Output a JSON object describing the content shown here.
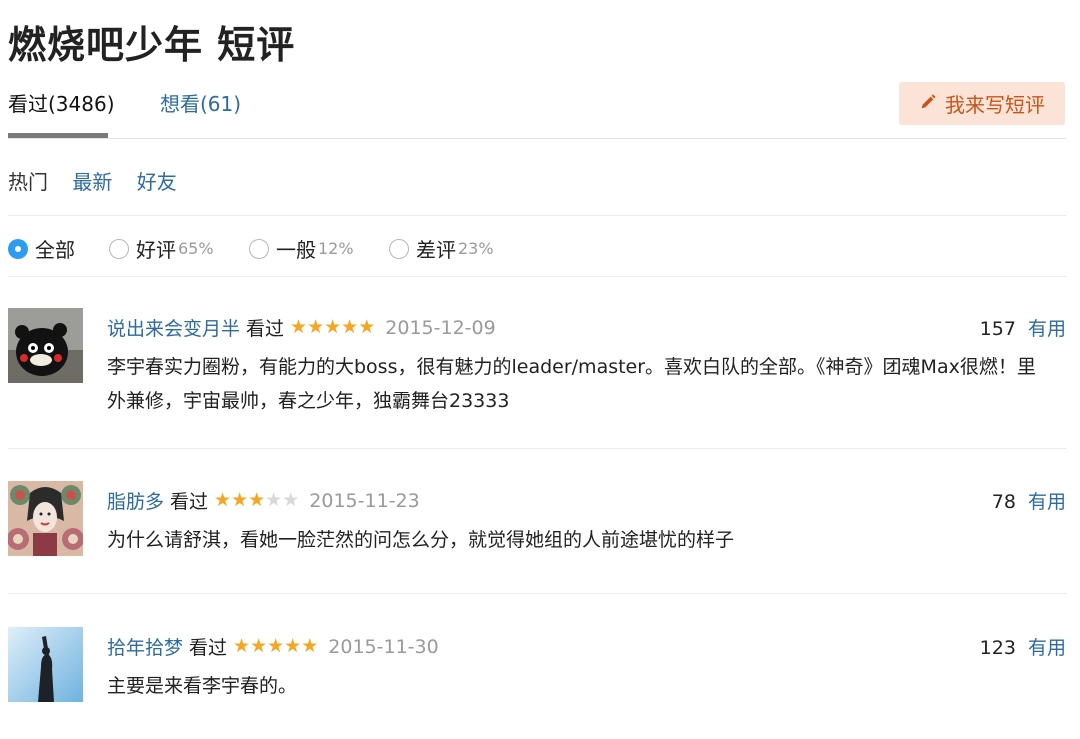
{
  "page": {
    "title": "燃烧吧少年 短评"
  },
  "tabs": {
    "watched": "看过(3486)",
    "want": "想看(61)"
  },
  "write_button": {
    "label": "我来写短评",
    "accent": "#c9541b",
    "bg": "#fbe4d7"
  },
  "sorts": {
    "hot": "热门",
    "latest": "最新",
    "friends": "好友"
  },
  "filters": {
    "all": {
      "label": "全部",
      "checked": true
    },
    "good": {
      "label": "好评",
      "pct": "65%"
    },
    "neutral": {
      "label": "一般",
      "pct": "12%"
    },
    "bad": {
      "label": "差评",
      "pct": "23%"
    }
  },
  "comments": [
    {
      "user": "说出来会变月半",
      "status": "看过",
      "rating": 5,
      "date": "2015-12-09",
      "votes": "157",
      "useful": "有用",
      "text": "李宇春实力圈粉，有能力的大boss，很有魅力的leader/master。喜欢白队的全部。《神奇》团魂Max很燃！里外兼修，宇宙最帅，春之少年，独霸舞台23333"
    },
    {
      "user": "脂肪多",
      "status": "看过",
      "rating": 3,
      "date": "2015-11-23",
      "votes": "78",
      "useful": "有用",
      "text": "为什么请舒淇，看她一脸茫然的问怎么分，就觉得她组的人前途堪忧的样子"
    },
    {
      "user": "拾年拾梦",
      "status": "看过",
      "rating": 5,
      "date": "2015-11-30",
      "votes": "123",
      "useful": "有用",
      "text": "主要是来看李宇春的。"
    }
  ],
  "colors": {
    "link": "#2e6b9e",
    "star": "#f5a623",
    "radio_checked": "#2c9cf0"
  }
}
